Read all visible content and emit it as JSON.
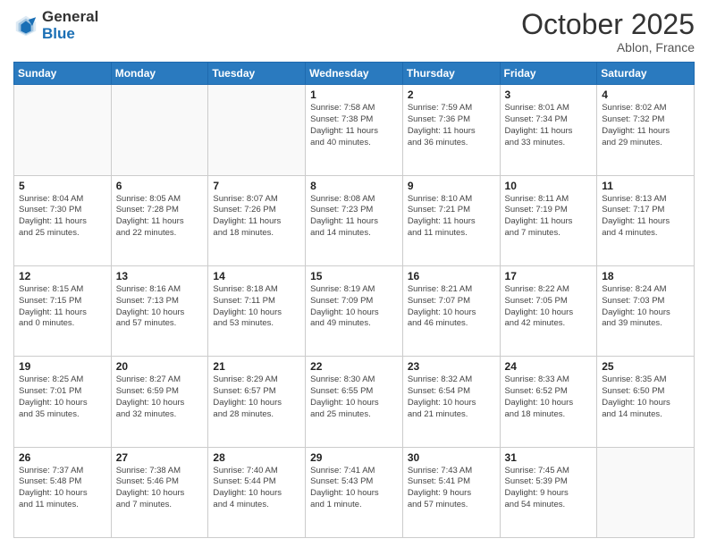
{
  "header": {
    "logo_general": "General",
    "logo_blue": "Blue",
    "month": "October 2025",
    "location": "Ablon, France"
  },
  "days_of_week": [
    "Sunday",
    "Monday",
    "Tuesday",
    "Wednesday",
    "Thursday",
    "Friday",
    "Saturday"
  ],
  "weeks": [
    [
      {
        "day": "",
        "info": ""
      },
      {
        "day": "",
        "info": ""
      },
      {
        "day": "",
        "info": ""
      },
      {
        "day": "1",
        "info": "Sunrise: 7:58 AM\nSunset: 7:38 PM\nDaylight: 11 hours\nand 40 minutes."
      },
      {
        "day": "2",
        "info": "Sunrise: 7:59 AM\nSunset: 7:36 PM\nDaylight: 11 hours\nand 36 minutes."
      },
      {
        "day": "3",
        "info": "Sunrise: 8:01 AM\nSunset: 7:34 PM\nDaylight: 11 hours\nand 33 minutes."
      },
      {
        "day": "4",
        "info": "Sunrise: 8:02 AM\nSunset: 7:32 PM\nDaylight: 11 hours\nand 29 minutes."
      }
    ],
    [
      {
        "day": "5",
        "info": "Sunrise: 8:04 AM\nSunset: 7:30 PM\nDaylight: 11 hours\nand 25 minutes."
      },
      {
        "day": "6",
        "info": "Sunrise: 8:05 AM\nSunset: 7:28 PM\nDaylight: 11 hours\nand 22 minutes."
      },
      {
        "day": "7",
        "info": "Sunrise: 8:07 AM\nSunset: 7:26 PM\nDaylight: 11 hours\nand 18 minutes."
      },
      {
        "day": "8",
        "info": "Sunrise: 8:08 AM\nSunset: 7:23 PM\nDaylight: 11 hours\nand 14 minutes."
      },
      {
        "day": "9",
        "info": "Sunrise: 8:10 AM\nSunset: 7:21 PM\nDaylight: 11 hours\nand 11 minutes."
      },
      {
        "day": "10",
        "info": "Sunrise: 8:11 AM\nSunset: 7:19 PM\nDaylight: 11 hours\nand 7 minutes."
      },
      {
        "day": "11",
        "info": "Sunrise: 8:13 AM\nSunset: 7:17 PM\nDaylight: 11 hours\nand 4 minutes."
      }
    ],
    [
      {
        "day": "12",
        "info": "Sunrise: 8:15 AM\nSunset: 7:15 PM\nDaylight: 11 hours\nand 0 minutes."
      },
      {
        "day": "13",
        "info": "Sunrise: 8:16 AM\nSunset: 7:13 PM\nDaylight: 10 hours\nand 57 minutes."
      },
      {
        "day": "14",
        "info": "Sunrise: 8:18 AM\nSunset: 7:11 PM\nDaylight: 10 hours\nand 53 minutes."
      },
      {
        "day": "15",
        "info": "Sunrise: 8:19 AM\nSunset: 7:09 PM\nDaylight: 10 hours\nand 49 minutes."
      },
      {
        "day": "16",
        "info": "Sunrise: 8:21 AM\nSunset: 7:07 PM\nDaylight: 10 hours\nand 46 minutes."
      },
      {
        "day": "17",
        "info": "Sunrise: 8:22 AM\nSunset: 7:05 PM\nDaylight: 10 hours\nand 42 minutes."
      },
      {
        "day": "18",
        "info": "Sunrise: 8:24 AM\nSunset: 7:03 PM\nDaylight: 10 hours\nand 39 minutes."
      }
    ],
    [
      {
        "day": "19",
        "info": "Sunrise: 8:25 AM\nSunset: 7:01 PM\nDaylight: 10 hours\nand 35 minutes."
      },
      {
        "day": "20",
        "info": "Sunrise: 8:27 AM\nSunset: 6:59 PM\nDaylight: 10 hours\nand 32 minutes."
      },
      {
        "day": "21",
        "info": "Sunrise: 8:29 AM\nSunset: 6:57 PM\nDaylight: 10 hours\nand 28 minutes."
      },
      {
        "day": "22",
        "info": "Sunrise: 8:30 AM\nSunset: 6:55 PM\nDaylight: 10 hours\nand 25 minutes."
      },
      {
        "day": "23",
        "info": "Sunrise: 8:32 AM\nSunset: 6:54 PM\nDaylight: 10 hours\nand 21 minutes."
      },
      {
        "day": "24",
        "info": "Sunrise: 8:33 AM\nSunset: 6:52 PM\nDaylight: 10 hours\nand 18 minutes."
      },
      {
        "day": "25",
        "info": "Sunrise: 8:35 AM\nSunset: 6:50 PM\nDaylight: 10 hours\nand 14 minutes."
      }
    ],
    [
      {
        "day": "26",
        "info": "Sunrise: 7:37 AM\nSunset: 5:48 PM\nDaylight: 10 hours\nand 11 minutes."
      },
      {
        "day": "27",
        "info": "Sunrise: 7:38 AM\nSunset: 5:46 PM\nDaylight: 10 hours\nand 7 minutes."
      },
      {
        "day": "28",
        "info": "Sunrise: 7:40 AM\nSunset: 5:44 PM\nDaylight: 10 hours\nand 4 minutes."
      },
      {
        "day": "29",
        "info": "Sunrise: 7:41 AM\nSunset: 5:43 PM\nDaylight: 10 hours\nand 1 minute."
      },
      {
        "day": "30",
        "info": "Sunrise: 7:43 AM\nSunset: 5:41 PM\nDaylight: 9 hours\nand 57 minutes."
      },
      {
        "day": "31",
        "info": "Sunrise: 7:45 AM\nSunset: 5:39 PM\nDaylight: 9 hours\nand 54 minutes."
      },
      {
        "day": "",
        "info": ""
      }
    ]
  ]
}
